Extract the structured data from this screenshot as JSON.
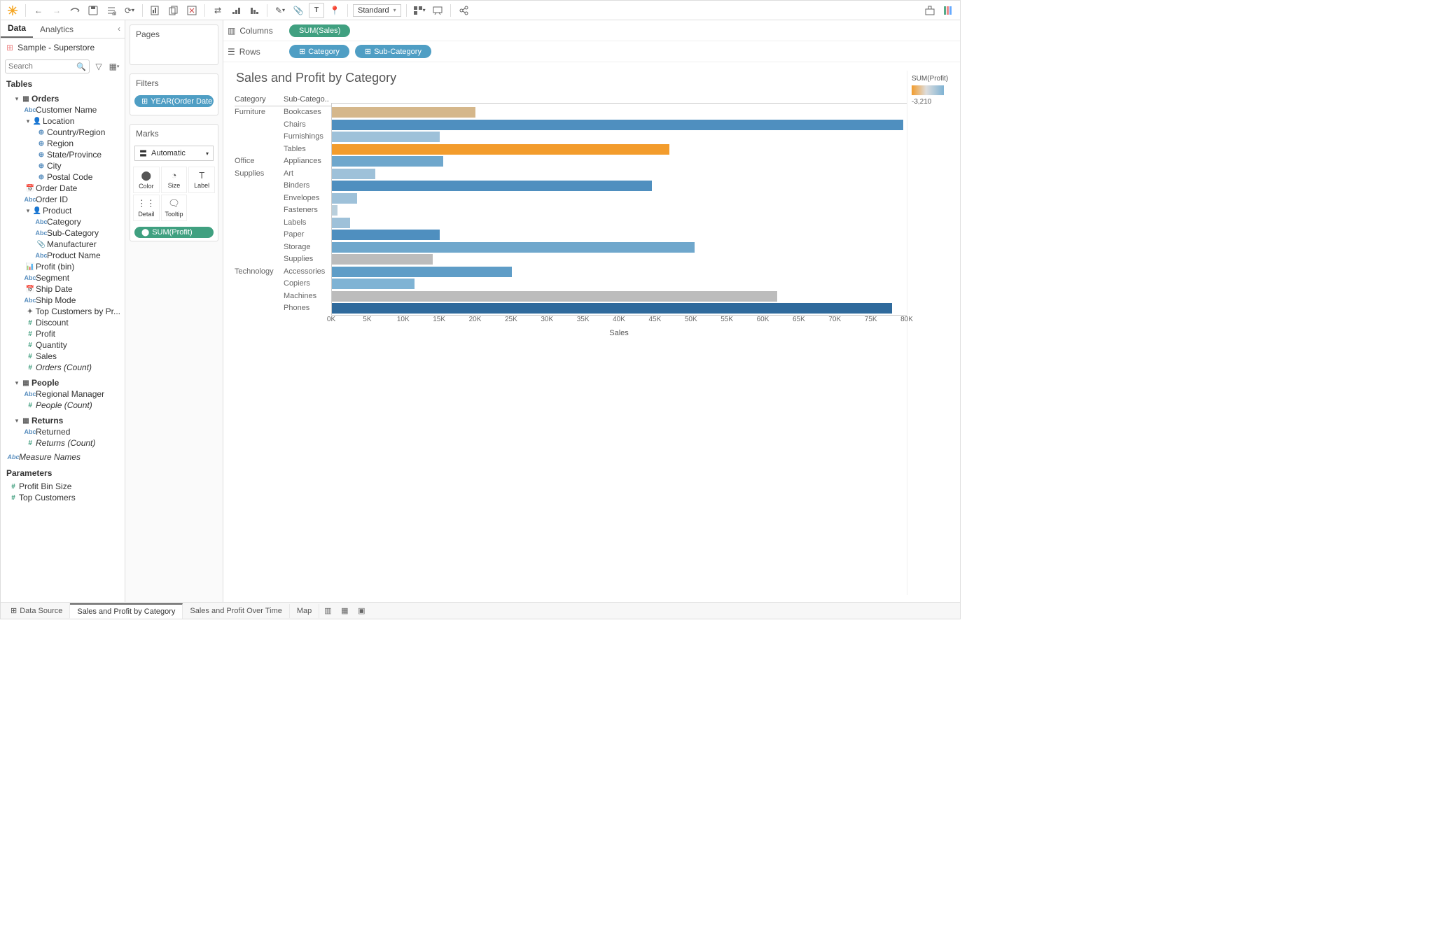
{
  "toolbar": {
    "fit": "Standard"
  },
  "side_tabs": {
    "data": "Data",
    "analytics": "Analytics"
  },
  "datasource": "Sample - Superstore",
  "search_placeholder": "Search",
  "tables_label": "Tables",
  "parameters_label": "Parameters",
  "tree": {
    "orders": "Orders",
    "customer_name": "Customer Name",
    "location": "Location",
    "country_region": "Country/Region",
    "region": "Region",
    "state_province": "State/Province",
    "city": "City",
    "postal_code": "Postal Code",
    "order_date": "Order Date",
    "order_id": "Order ID",
    "product": "Product",
    "category": "Category",
    "sub_category": "Sub-Category",
    "manufacturer": "Manufacturer",
    "product_name": "Product Name",
    "profit_bin": "Profit (bin)",
    "segment": "Segment",
    "ship_date": "Ship Date",
    "ship_mode": "Ship Mode",
    "top_customers": "Top Customers by Pr...",
    "discount": "Discount",
    "profit": "Profit",
    "quantity": "Quantity",
    "sales": "Sales",
    "orders_count": "Orders (Count)",
    "people": "People",
    "regional_manager": "Regional Manager",
    "people_count": "People (Count)",
    "returns": "Returns",
    "returned": "Returned",
    "returns_count": "Returns (Count)",
    "measure_names": "Measure Names"
  },
  "parameters": {
    "profit_bin_size": "Profit Bin Size",
    "top_customers": "Top Customers"
  },
  "shelves": {
    "pages": "Pages",
    "filters": "Filters",
    "filter_pill": "YEAR(Order Date..",
    "marks": "Marks",
    "marks_type": "Automatic",
    "color": "Color",
    "size": "Size",
    "label": "Label",
    "detail": "Detail",
    "tooltip": "Tooltip",
    "mark_pill": "SUM(Profit)"
  },
  "shelf_row": {
    "columns": "Columns",
    "rows": "Rows",
    "col_pill": "SUM(Sales)",
    "row_pill1": "Category",
    "row_pill2": "Sub-Category"
  },
  "chart": {
    "title": "Sales and Profit by Category",
    "hdr_cat": "Category",
    "hdr_sub": "Sub-Catego..",
    "axis_title": "Sales"
  },
  "legend": {
    "title": "SUM(Profit)",
    "low": "-3,210"
  },
  "chart_data": {
    "type": "bar",
    "xlabel": "Sales",
    "xlim": [
      0,
      80000
    ],
    "xticks": [
      "0K",
      "5K",
      "10K",
      "15K",
      "20K",
      "25K",
      "30K",
      "35K",
      "40K",
      "45K",
      "50K",
      "55K",
      "60K",
      "65K",
      "70K",
      "75K",
      "80K"
    ],
    "groups": [
      {
        "category": "Furniture",
        "rows": [
          {
            "sub": "Bookcases",
            "value": 20000,
            "color": "#d5b78b"
          },
          {
            "sub": "Chairs",
            "value": 79500,
            "color": "#4f8fbf"
          },
          {
            "sub": "Furnishings",
            "value": 15000,
            "color": "#9ec1d9"
          },
          {
            "sub": "Tables",
            "value": 47000,
            "color": "#f39c2c"
          }
        ]
      },
      {
        "category": "Office Supplies",
        "rows": [
          {
            "sub": "Appliances",
            "value": 15500,
            "color": "#6fa7cc"
          },
          {
            "sub": "Art",
            "value": 6000,
            "color": "#9ec1d9"
          },
          {
            "sub": "Binders",
            "value": 44500,
            "color": "#4f8fbf"
          },
          {
            "sub": "Envelopes",
            "value": 3500,
            "color": "#9ec1d9"
          },
          {
            "sub": "Fasteners",
            "value": 800,
            "color": "#b9cfdc"
          },
          {
            "sub": "Labels",
            "value": 2500,
            "color": "#9ec1d9"
          },
          {
            "sub": "Paper",
            "value": 15000,
            "color": "#4f8fbf"
          },
          {
            "sub": "Storage",
            "value": 50500,
            "color": "#6fa7cc"
          },
          {
            "sub": "Supplies",
            "value": 14000,
            "color": "#bcbcbc"
          }
        ]
      },
      {
        "category": "Technology",
        "rows": [
          {
            "sub": "Accessories",
            "value": 25000,
            "color": "#5f9dc7"
          },
          {
            "sub": "Copiers",
            "value": 11500,
            "color": "#7fb3d4"
          },
          {
            "sub": "Machines",
            "value": 62000,
            "color": "#bcbcbc"
          },
          {
            "sub": "Phones",
            "value": 78000,
            "color": "#2f6a9c"
          }
        ]
      }
    ]
  },
  "footer": {
    "data_source": "Data Source",
    "tab1": "Sales and Profit by Category",
    "tab2": "Sales and Profit Over Time",
    "tab3": "Map"
  }
}
